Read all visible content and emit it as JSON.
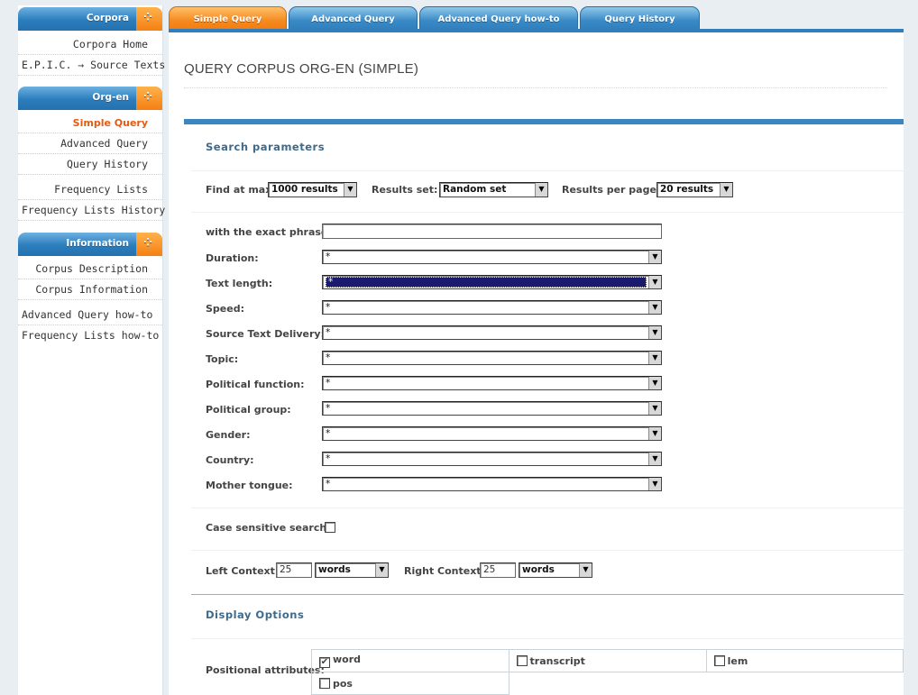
{
  "sidebar": {
    "sections": [
      {
        "title": "Corpora",
        "items": [
          "Corpora Home",
          "E.P.I.C. → Source Texts"
        ]
      },
      {
        "title": "Org-en",
        "items": [
          "Simple Query",
          "Advanced Query",
          "Query History",
          "Frequency Lists",
          "Frequency Lists History"
        ],
        "active": "Simple Query"
      },
      {
        "title": "Information",
        "items": [
          "Corpus Description",
          "Corpus Information",
          "Advanced Query how-to",
          "Frequency Lists how-to"
        ]
      }
    ]
  },
  "tabs": [
    "Simple Query",
    "Advanced Query",
    "Advanced Query how-to",
    "Query History"
  ],
  "active_tab": "Simple Query",
  "page": {
    "title": "QUERY CORPUS ORG-EN (SIMPLE)"
  },
  "search": {
    "section_title": "Search parameters",
    "find_at_max_label": "Find at max",
    "find_at_max_value": "1000 results",
    "results_set_label": "Results set:",
    "results_set_value": "Random set",
    "results_per_page_label": "Results per page:",
    "results_per_page_value": "20 results",
    "exact_phrase_label": "with the exact phrase:",
    "exact_phrase_value": "",
    "filters": [
      {
        "label": "Duration:",
        "value": "*"
      },
      {
        "label": "Text length:",
        "value": "*"
      },
      {
        "label": "Speed:",
        "value": "*"
      },
      {
        "label": "Source Text Delivery:",
        "value": "*"
      },
      {
        "label": "Topic:",
        "value": "*"
      },
      {
        "label": "Political function:",
        "value": "*"
      },
      {
        "label": "Political group:",
        "value": "*"
      },
      {
        "label": "Gender:",
        "value": "*"
      },
      {
        "label": "Country:",
        "value": "*"
      },
      {
        "label": "Mother tongue:",
        "value": "*"
      }
    ],
    "case_sensitive_label": "Case sensitive search",
    "case_sensitive_checked": false,
    "left_context_label": "Left Context:",
    "left_context_value": "25",
    "left_context_unit": "words",
    "right_context_label": "Right Context:",
    "right_context_value": "25",
    "right_context_unit": "words"
  },
  "display": {
    "section_title": "Display Options",
    "positional_label": "Positional attributes:",
    "attributes": [
      {
        "name": "word",
        "checked": true
      },
      {
        "name": "transcript",
        "checked": false
      },
      {
        "name": "lem",
        "checked": false
      },
      {
        "name": "pos",
        "checked": false
      }
    ]
  },
  "colors": {
    "accent_blue": "#2f7fbd",
    "accent_orange": "#f58a1f",
    "active_link": "#e85a10"
  },
  "icons": {
    "sidebar_header": "dots-icon",
    "select_arrow": "chevron-down-icon",
    "check": "check-icon"
  }
}
